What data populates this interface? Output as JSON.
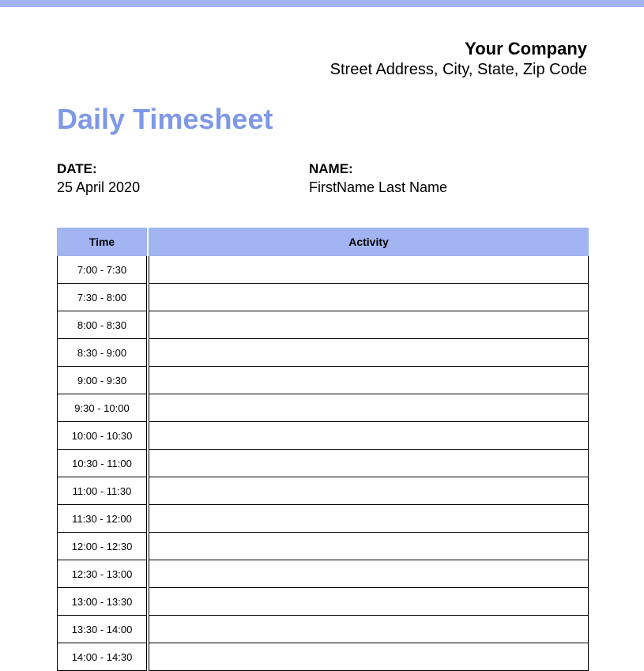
{
  "header": {
    "company_name": "Your Company",
    "company_address": "Street Address, City, State, Zip Code"
  },
  "title": "Daily Timesheet",
  "meta": {
    "date_label": "DATE:",
    "date_value": "25 April 2020",
    "name_label": "NAME:",
    "name_value": "FirstName Last Name"
  },
  "table": {
    "headers": {
      "time": "Time",
      "activity": "Activity"
    },
    "rows": [
      {
        "time": "7:00 - 7:30",
        "activity": ""
      },
      {
        "time": "7:30 - 8:00",
        "activity": ""
      },
      {
        "time": "8:00 - 8:30",
        "activity": ""
      },
      {
        "time": "8:30 - 9:00",
        "activity": ""
      },
      {
        "time": "9:00 - 9:30",
        "activity": ""
      },
      {
        "time": "9:30 - 10:00",
        "activity": ""
      },
      {
        "time": "10:00 - 10:30",
        "activity": ""
      },
      {
        "time": "10:30 - 11:00",
        "activity": ""
      },
      {
        "time": "11:00 - 11:30",
        "activity": ""
      },
      {
        "time": "11:30 - 12:00",
        "activity": ""
      },
      {
        "time": "12:00 - 12:30",
        "activity": ""
      },
      {
        "time": "12:30 - 13:00",
        "activity": ""
      },
      {
        "time": "13:00 - 13:30",
        "activity": ""
      },
      {
        "time": "13:30 - 14:00",
        "activity": ""
      },
      {
        "time": "14:00 - 14:30",
        "activity": ""
      }
    ]
  }
}
